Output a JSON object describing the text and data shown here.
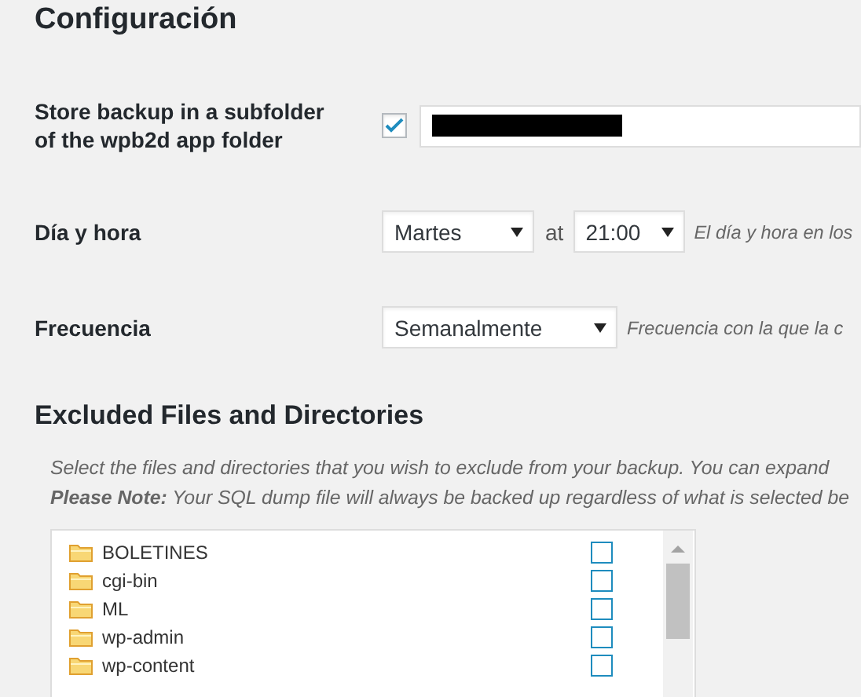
{
  "heading": "Configuración",
  "settings": [
    {
      "kind": "checkbox_field",
      "label": "Store backup in a subfolder of the wpb2d app folder",
      "checked": true,
      "redacted": true
    },
    {
      "kind": "day_time",
      "label": "Día y hora",
      "day": "Martes",
      "separator": "at",
      "time": "21:00",
      "hint": "El día y hora en los"
    },
    {
      "kind": "select",
      "label": "Frecuencia",
      "value": "Semanalmente",
      "hint": "Frecuencia con la que la c"
    }
  ],
  "excluded": {
    "title": "Excluded Files and Directories",
    "description": "Select the files and directories that you wish to exclude from your backup. You can expand",
    "note": "**Please Note:** Your SQL dump file will always be backed up regardless of what is selected be",
    "items": [
      {
        "name": "BOLETINES",
        "checked": false
      },
      {
        "name": "cgi-bin",
        "checked": false
      },
      {
        "name": "ML",
        "checked": false
      },
      {
        "name": "wp-admin",
        "checked": false
      },
      {
        "name": "wp-content",
        "checked": false
      }
    ]
  }
}
